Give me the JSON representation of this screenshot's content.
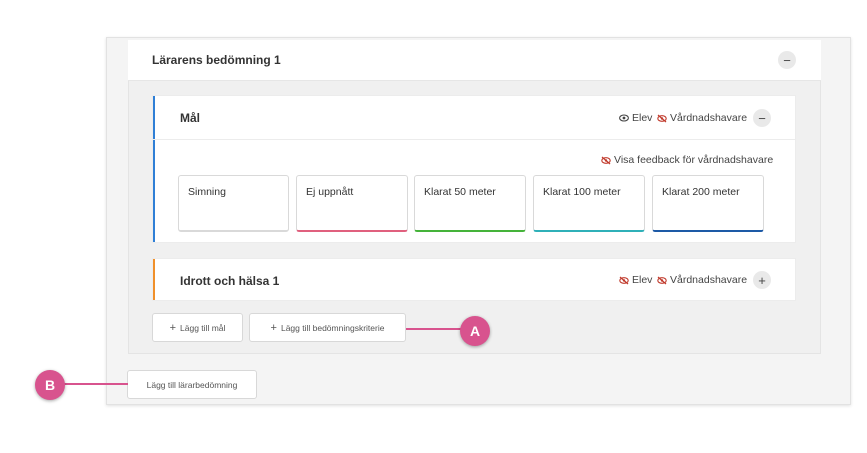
{
  "assessment": {
    "title": "Lärarens bedömning 1",
    "toggle_symbol": "−"
  },
  "goal_card": {
    "title": "Mål",
    "accent_color": "#2f7fd6",
    "visibility": {
      "student_label": "Elev",
      "student_icon": "eye-icon",
      "guardian_label": "Vårdnadshavare",
      "guardian_icon": "eye-slash-icon"
    },
    "toggle_symbol": "−",
    "feedback_toggle_label": "Visa feedback för vårdnadshavare",
    "criteria": [
      {
        "label": "Simning",
        "color": "#d9d9d9"
      },
      {
        "label": "Ej uppnått",
        "color": "#e0607e"
      },
      {
        "label": "Klarat 50 meter",
        "color": "#45b33a"
      },
      {
        "label": "Klarat 100 meter",
        "color": "#2fb0b8"
      },
      {
        "label": "Klarat 200 meter",
        "color": "#1d5aa6"
      }
    ]
  },
  "subject_card": {
    "title": "Idrott och hälsa 1",
    "accent_color": "#f0902a",
    "visibility": {
      "student_label": "Elev",
      "student_icon": "eye-slash-icon",
      "guardian_label": "Vårdnadshavare",
      "guardian_icon": "eye-slash-icon"
    },
    "toggle_symbol": "+"
  },
  "actions": {
    "add_goal": "Lägg till mål",
    "add_criteria": "Lägg till bedömningskriterie",
    "add_teacher_assessment": "Lägg till lärarbedömning",
    "plus_symbol": "+"
  },
  "callouts": {
    "a": "A",
    "b": "B",
    "color": "#d8538e"
  },
  "colors": {
    "hidden_icon": "#c0392b"
  }
}
